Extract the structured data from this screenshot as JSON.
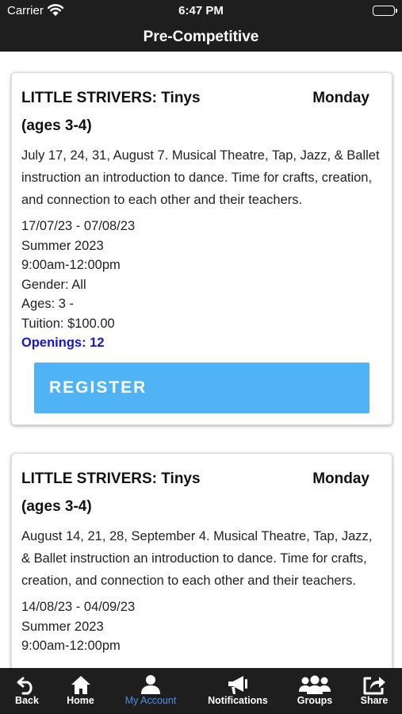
{
  "status_bar": {
    "carrier": "Carrier",
    "time": "6:47 PM"
  },
  "nav": {
    "title": "Pre-Competitive"
  },
  "classes": [
    {
      "title_line1": "LITTLE STRIVERS: Tinys",
      "title_line2": "(ages 3-4)",
      "day": "Monday",
      "description": "July 17, 24, 31, August 7. Musical Theatre, Tap, Jazz, & Ballet instruction an introduction to dance. Time for crafts, creation, and connection to each other and their teachers.",
      "dates": "17/07/23 - 07/08/23",
      "session": "Summer 2023",
      "time": "9:00am-12:00pm",
      "gender": "Gender: All",
      "ages": "Ages: 3 -",
      "tuition": "Tuition: $100.00",
      "openings": "Openings: 12",
      "register_label": "REGISTER"
    },
    {
      "title_line1": "LITTLE STRIVERS: Tinys",
      "title_line2": "(ages 3-4)",
      "day": "Monday",
      "description": "August 14, 21, 28, September 4. Musical Theatre, Tap, Jazz, & Ballet instruction an introduction to dance. Time for crafts, creation, and connection to each other and their teachers.",
      "dates": "14/08/23 - 04/09/23",
      "session": "Summer 2023",
      "time": "9:00am-12:00pm"
    }
  ],
  "tab_bar": {
    "items": [
      {
        "label": "Back",
        "icon": "back-arrow-icon"
      },
      {
        "label": "Home",
        "icon": "home-icon"
      },
      {
        "label": "My Account",
        "icon": "user-icon",
        "active": true
      },
      {
        "label": "Notifications",
        "icon": "megaphone-icon"
      },
      {
        "label": "Groups",
        "icon": "group-icon"
      },
      {
        "label": "Share",
        "icon": "share-icon"
      }
    ]
  },
  "colors": {
    "bar_background": "#1e1e1e",
    "register_button": "#4fb3f5",
    "openings_text": "#1515d6",
    "active_tab": "#4a90e2"
  }
}
